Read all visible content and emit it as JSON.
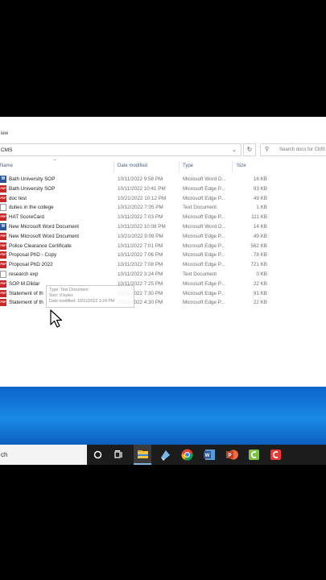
{
  "ribbon": {
    "view_label": "iew"
  },
  "address": {
    "path": "CMS",
    "search_placeholder": "Search docs for CMS"
  },
  "columns": {
    "name": "Name",
    "date": "Date modified",
    "type": "Type",
    "size": "Size"
  },
  "files": [
    {
      "name": "Bath University SOP",
      "date": "10/11/2022 9:58 PM",
      "type": "Microsoft Word D...",
      "size": "16 KB",
      "icon": "word"
    },
    {
      "name": "Bath University SOP",
      "date": "10/11/2022 10:41 PM",
      "type": "Microsoft Edge P...",
      "size": "93 KB",
      "icon": "pdf"
    },
    {
      "name": "doc test",
      "date": "10/21/2022 10:12 PM",
      "type": "Microsoft Edge P...",
      "size": "49 KB",
      "icon": "pdf"
    },
    {
      "name": "duties in the college",
      "date": "10/12/2022 7:05 PM",
      "type": "Text Document",
      "size": "1 KB",
      "icon": "txt"
    },
    {
      "name": "HAT ScoreCard",
      "date": "10/11/2022 7:03 PM",
      "type": "Microsoft Edge P...",
      "size": "111 KB",
      "icon": "pdf"
    },
    {
      "name": "New Microsoft Word Document",
      "date": "10/11/2022 10:08 PM",
      "type": "Microsoft Word D...",
      "size": "14 KB",
      "icon": "word"
    },
    {
      "name": "New Microsoft Word Document",
      "date": "10/21/2022 9:09 PM",
      "type": "Microsoft Edge P...",
      "size": "49 KB",
      "icon": "pdf"
    },
    {
      "name": "Police Clearance Certificate",
      "date": "10/11/2022 7:01 PM",
      "type": "Microsoft Edge P...",
      "size": "562 KB",
      "icon": "pdf"
    },
    {
      "name": "Proposal PhD  - Copy",
      "date": "10/11/2022 7:06 PM",
      "type": "Microsoft Edge P...",
      "size": "78 KB",
      "icon": "pdf"
    },
    {
      "name": "Proposal PhD  2022",
      "date": "10/11/2022 7:08 PM",
      "type": "Microsoft Edge P...",
      "size": "721 KB",
      "icon": "pdf"
    },
    {
      "name": "research exp",
      "date": "10/11/2022 3:24 PM",
      "type": "Text Document",
      "size": "0 KB",
      "icon": "txt"
    },
    {
      "name": "SOP M.Dildar",
      "date": "10/11/2022 7:25 PM",
      "type": "Microsoft Edge P...",
      "size": "22 KB",
      "icon": "pdf"
    },
    {
      "name": "Statement of th",
      "date": "10/11/2022 7:30 PM",
      "type": "Microsoft Edge P...",
      "size": "91 KB",
      "icon": "pdf"
    },
    {
      "name": "Statement of th",
      "date": "10/11/2022 4:30 PM",
      "type": "Microsoft Edge P...",
      "size": "22 KB",
      "icon": "pdf"
    }
  ],
  "tooltip": {
    "type_line": "Type: Text Document",
    "size_line": "Size: 0 bytes",
    "date_line": "Date modified: 10/11/2022 3:24 PM"
  },
  "taskbar": {
    "search_text": "ch"
  },
  "colors": {
    "desktop": "#1a8ae6",
    "taskbar": "#1c1c1c",
    "pdf": "#c62828",
    "word": "#2b579a"
  }
}
